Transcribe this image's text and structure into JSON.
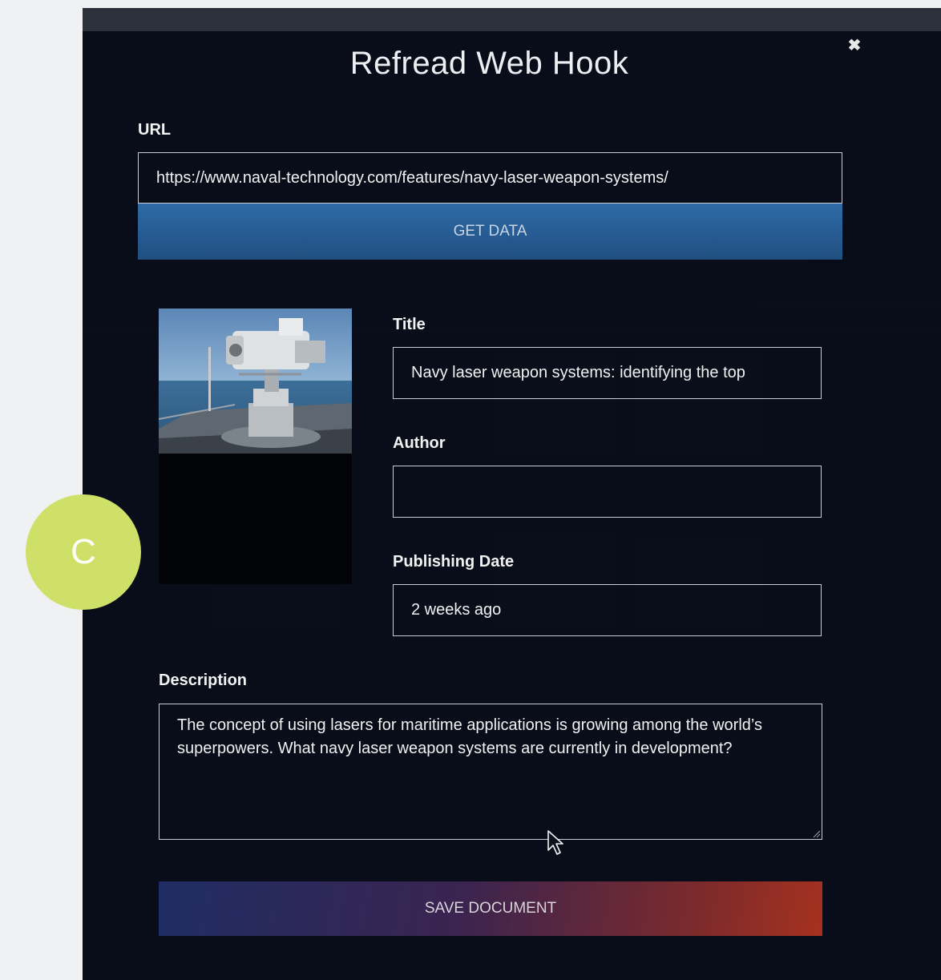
{
  "modal": {
    "title": "Refread Web Hook",
    "close_icon": "close-icon"
  },
  "url_section": {
    "label": "URL",
    "value": "https://www.naval-technology.com/features/navy-laser-weapon-systems/",
    "get_data_label": "GET DATA"
  },
  "preview_image": {
    "icon": "laser-weapon-photo"
  },
  "fields": {
    "title": {
      "label": "Title",
      "value": "Navy laser weapon systems: identifying the top"
    },
    "author": {
      "label": "Author",
      "value": ""
    },
    "publishing_date": {
      "label": "Publishing Date",
      "value": "2 weeks ago"
    }
  },
  "description": {
    "label": "Description",
    "value": "The concept of using lasers for maritime applications is growing among the world’s superpowers. What navy laser weapon systems are currently in development?"
  },
  "save_label": "SAVE DOCUMENT",
  "avatar": {
    "initial": "C",
    "color": "#cfe069"
  },
  "colors": {
    "get_data_button": "#2a5f96",
    "save_gradient_start": "#1f2d63",
    "save_gradient_end": "#a5311f",
    "modal_background": "#0b111d"
  }
}
